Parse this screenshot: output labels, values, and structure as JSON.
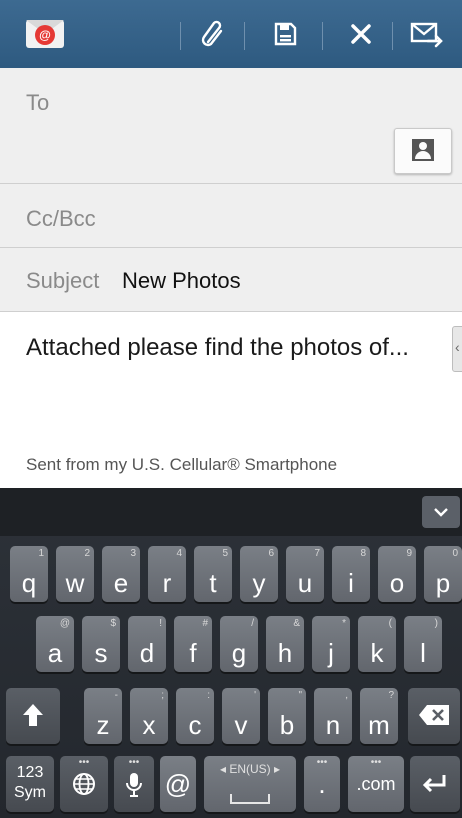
{
  "actionbar": {
    "app_icon": "email-app-icon",
    "app_icon_letter": "@",
    "actions": [
      {
        "name": "attach-icon",
        "symbol": "paperclip"
      },
      {
        "name": "save-icon",
        "symbol": "save-draft"
      },
      {
        "name": "close-icon",
        "symbol": "x"
      },
      {
        "name": "send-icon",
        "symbol": "envelope-arrow"
      }
    ]
  },
  "compose": {
    "to_label": "To",
    "cc_label": "Cc/Bcc",
    "subject_label": "Subject",
    "subject_value": "New Photos",
    "body": "Attached please find the photos of...",
    "signature": "Sent from my U.S. Cellular® Smartphone"
  },
  "keyboard": {
    "row1": [
      {
        "k": "q",
        "s": "1"
      },
      {
        "k": "w",
        "s": "2"
      },
      {
        "k": "e",
        "s": "3"
      },
      {
        "k": "r",
        "s": "4"
      },
      {
        "k": "t",
        "s": "5"
      },
      {
        "k": "y",
        "s": "6"
      },
      {
        "k": "u",
        "s": "7"
      },
      {
        "k": "i",
        "s": "8"
      },
      {
        "k": "o",
        "s": "9"
      },
      {
        "k": "p",
        "s": "0"
      }
    ],
    "row2": [
      {
        "k": "a",
        "s": "@"
      },
      {
        "k": "s",
        "s": "$"
      },
      {
        "k": "d",
        "s": "!"
      },
      {
        "k": "f",
        "s": "#"
      },
      {
        "k": "g",
        "s": "/"
      },
      {
        "k": "h",
        "s": "&"
      },
      {
        "k": "j",
        "s": "*"
      },
      {
        "k": "k",
        "s": "("
      },
      {
        "k": "l",
        "s": ")"
      }
    ],
    "row3": [
      {
        "k": "z",
        "s": "-"
      },
      {
        "k": "x",
        "s": ";"
      },
      {
        "k": "c",
        "s": ":"
      },
      {
        "k": "v",
        "s": "'"
      },
      {
        "k": "b",
        "s": "\""
      },
      {
        "k": "n",
        "s": ","
      },
      {
        "k": "m",
        "s": "?"
      }
    ],
    "sym_top": "123",
    "sym_bottom": "Sym",
    "at_key": "@",
    "language": "EN(US)",
    "period": ".",
    "dotcom": ".com",
    "colors": {
      "key": "#6d7178",
      "bar": "#2e5a80"
    }
  }
}
